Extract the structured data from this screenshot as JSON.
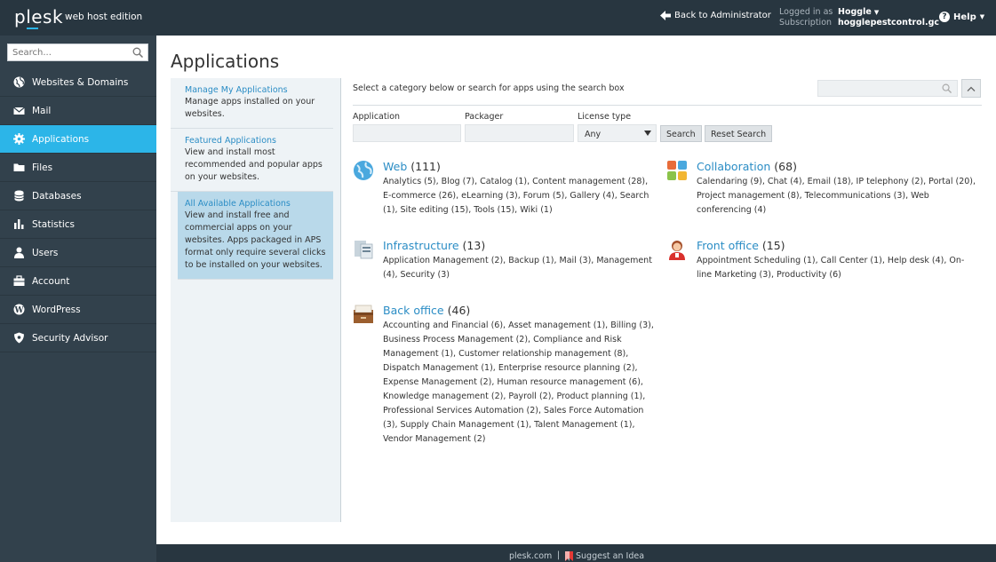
{
  "topbar": {
    "logo": "plesk",
    "edition": "web host edition",
    "back_link": "Back to Administrator",
    "logged_in_label": "Logged in as",
    "logged_in_user": "Hoggle",
    "subscription_label": "Subscription",
    "subscription_value": "hogglepestcontrol.gc",
    "help_label": "Help"
  },
  "sidebar": {
    "search_placeholder": "Search...",
    "items": [
      {
        "label": "Websites & Domains",
        "icon": "globe-icon"
      },
      {
        "label": "Mail",
        "icon": "envelope-icon"
      },
      {
        "label": "Applications",
        "icon": "gear-icon",
        "active": true
      },
      {
        "label": "Files",
        "icon": "folder-icon"
      },
      {
        "label": "Databases",
        "icon": "database-icon"
      },
      {
        "label": "Statistics",
        "icon": "bar-chart-icon"
      },
      {
        "label": "Users",
        "icon": "user-icon"
      },
      {
        "label": "Account",
        "icon": "briefcase-icon"
      },
      {
        "label": "WordPress",
        "icon": "wordpress-icon"
      },
      {
        "label": "Security Advisor",
        "icon": "shield-icon"
      }
    ]
  },
  "main": {
    "title": "Applications",
    "left_panel": [
      {
        "link": "Manage My Applications",
        "desc": "Manage apps installed on your websites."
      },
      {
        "link": "Featured Applications",
        "desc": "View and install most recommended and popular apps on your websites."
      },
      {
        "link": "All Available Applications",
        "desc": "View and install free and commercial apps on your websites. Apps packaged in APS format only require several clicks to be installed on your websites.",
        "active": true
      }
    ],
    "instruction": "Select a category below or search for apps using the search box",
    "filters": {
      "application_label": "Application",
      "packager_label": "Packager",
      "license_label": "License type",
      "license_value": "Any",
      "search_button": "Search",
      "reset_button": "Reset Search"
    },
    "categories": [
      {
        "name": "Web",
        "count": "(111)",
        "subs": "Analytics (5), Blog (7), Catalog (1), Content management (28), E-commerce (26), eLearning (3), Forum (5), Gallery (4), Search (1), Site editing (15), Tools (15), Wiki (1)",
        "icon": "globe-icon"
      },
      {
        "name": "Collaboration",
        "count": "(68)",
        "subs": "Calendaring (9), Chat (4), Email (18), IP telephony (2), Portal (20), Project management (8), Telecommunications (3), Web conferencing (4)",
        "icon": "puzzle-icon"
      },
      {
        "name": "Infrastructure",
        "count": "(13)",
        "subs": "Application Management (2), Backup (1), Mail (3), Management (4), Security (3)",
        "icon": "server-icon"
      },
      {
        "name": "Front office",
        "count": "(15)",
        "subs": "Appointment Scheduling (1), Call Center (1), Help desk (4), On-line Marketing (3), Productivity (6)",
        "icon": "receptionist-icon"
      },
      {
        "name": "Back office",
        "count": "(46)",
        "subs": "Accounting and Financial (6), Asset management (1), Billing (3), Business Process Management (2), Compliance and Risk Management (1), Customer relationship management (8), Dispatch Management (1), Enterprise resource planning (2), Expense Management (2), Human resource management (6), Knowledge management (2), Payroll (2), Product planning (1), Professional Services Automation (2), Sales Force Automation (3), Supply Chain Management (1), Talent Management (1), Vendor Management (2)",
        "icon": "file-drawer-icon"
      }
    ]
  },
  "footer": {
    "link1": "plesk.com",
    "separator": "|",
    "link2": "Suggest an Idea"
  },
  "colors": {
    "accent": "#2cb5e8",
    "sidebar_bg": "#32414c",
    "topbar_bg": "#283640",
    "link": "#2b8dc5"
  }
}
